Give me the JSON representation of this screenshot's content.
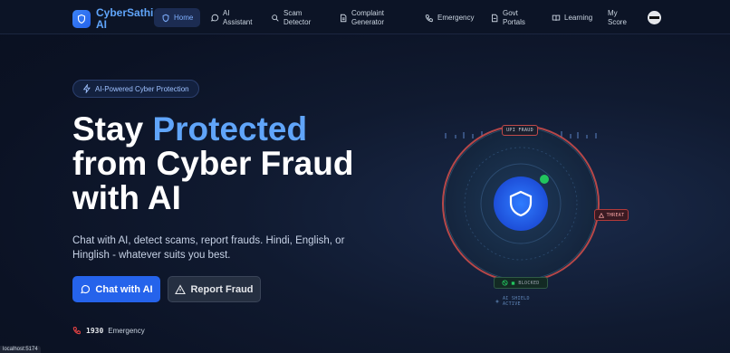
{
  "brand": {
    "name": "CyberSathi AI",
    "logo_icon": "shield-icon"
  },
  "nav": {
    "items": [
      {
        "label": "Home",
        "icon": "shield-icon",
        "active": true
      },
      {
        "label": "AI Assistant",
        "icon": "chat-icon"
      },
      {
        "label": "Scam Detector",
        "icon": "search-icon"
      },
      {
        "label": "Complaint Generator",
        "icon": "document-icon"
      },
      {
        "label": "Emergency",
        "icon": "phone-icon"
      },
      {
        "label": "Govt Portals",
        "icon": "file-icon"
      },
      {
        "label": "Learning",
        "icon": "book-icon"
      },
      {
        "label": "My Score",
        "icon": ""
      }
    ]
  },
  "hero": {
    "badge": "AI-Powered Cyber Protection",
    "title_line1_plain": "Stay ",
    "title_line1_accent": "Protected",
    "title_line2": "from Cyber Fraud",
    "title_line3": "with AI",
    "subtitle": "Chat with AI, detect scams, report frauds. Hindi, English, or Hinglish - whatever suits you best.",
    "primary_button": "Chat with AI",
    "secondary_button": "Report Fraud",
    "emergency_number": "1930",
    "emergency_label": "Emergency"
  },
  "visual": {
    "top_tag": "UPI FRAUD",
    "threat_tag": "THREAT",
    "blocked_tag": "BLOCKED",
    "shield_status": "AI SHIELD ACTIVE"
  },
  "status_bar": {
    "url": "localhost:5174"
  },
  "colors": {
    "accent": "#60a5fa",
    "primary": "#2563eb",
    "background": "#0b1224",
    "threat": "#ef4444",
    "success": "#22c55e"
  }
}
